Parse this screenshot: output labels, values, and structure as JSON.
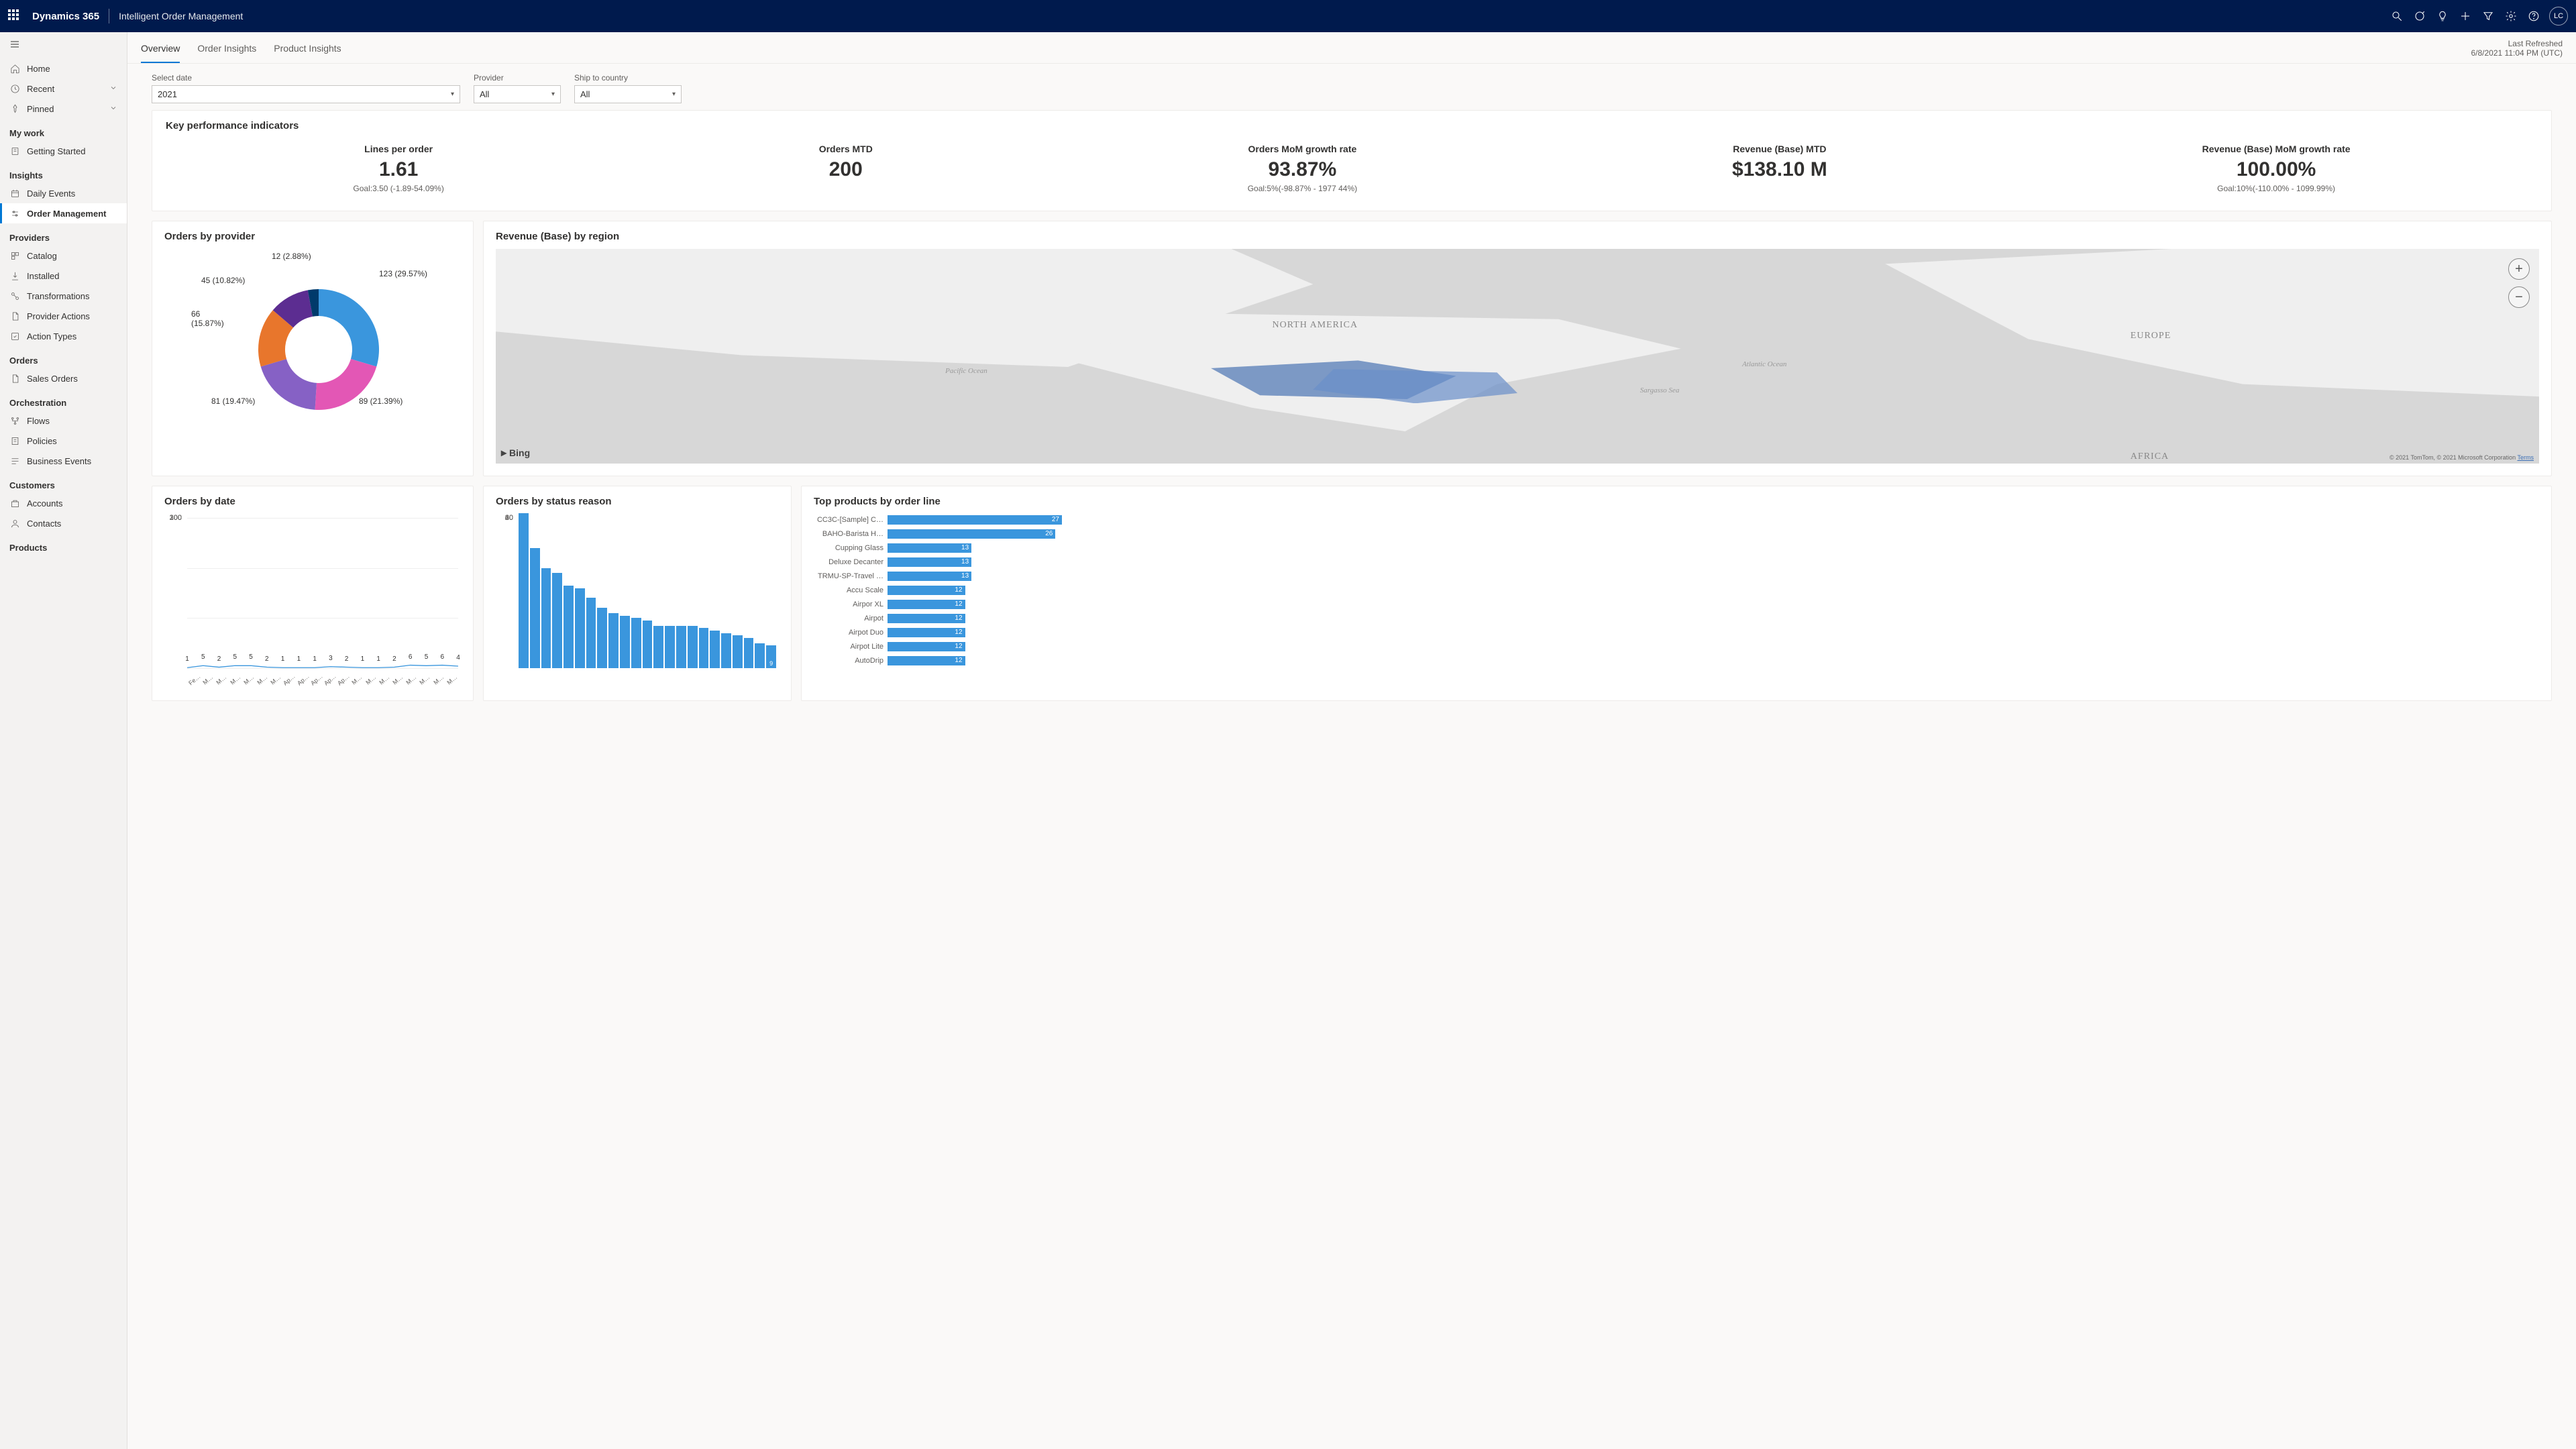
{
  "topbar": {
    "brand": "Dynamics 365",
    "app_name": "Intelligent Order Management",
    "avatar_initials": "LC"
  },
  "sidebar": {
    "builtin": [
      {
        "label": "Home",
        "icon": "home"
      },
      {
        "label": "Recent",
        "icon": "clock",
        "chevron": true
      },
      {
        "label": "Pinned",
        "icon": "pin",
        "chevron": true
      }
    ],
    "groups": [
      {
        "header": "My work",
        "items": [
          {
            "label": "Getting Started",
            "icon": "guide"
          }
        ]
      },
      {
        "header": "Insights",
        "items": [
          {
            "label": "Daily Events",
            "icon": "events"
          },
          {
            "label": "Order Management",
            "icon": "sliders",
            "active": true
          }
        ]
      },
      {
        "header": "Providers",
        "items": [
          {
            "label": "Catalog",
            "icon": "catalog"
          },
          {
            "label": "Installed",
            "icon": "download"
          },
          {
            "label": "Transformations",
            "icon": "transform"
          },
          {
            "label": "Provider Actions",
            "icon": "doc"
          },
          {
            "label": "Action Types",
            "icon": "action"
          }
        ]
      },
      {
        "header": "Orders",
        "items": [
          {
            "label": "Sales Orders",
            "icon": "doc"
          }
        ]
      },
      {
        "header": "Orchestration",
        "items": [
          {
            "label": "Flows",
            "icon": "flow"
          },
          {
            "label": "Policies",
            "icon": "policy"
          },
          {
            "label": "Business Events",
            "icon": "bevent"
          }
        ]
      },
      {
        "header": "Customers",
        "items": [
          {
            "label": "Accounts",
            "icon": "account"
          },
          {
            "label": "Contacts",
            "icon": "person"
          }
        ]
      },
      {
        "header": "Products",
        "items": []
      }
    ]
  },
  "tabs": [
    {
      "label": "Overview",
      "active": true
    },
    {
      "label": "Order Insights"
    },
    {
      "label": "Product Insights"
    }
  ],
  "last_refreshed": {
    "label": "Last Refreshed",
    "value": "6/8/2021 11:04 PM (UTC)"
  },
  "filters": {
    "date": {
      "label": "Select date",
      "value": "2021"
    },
    "provider": {
      "label": "Provider",
      "value": "All"
    },
    "ship_to": {
      "label": "Ship to country",
      "value": "All"
    }
  },
  "kpi": {
    "title": "Key performance indicators",
    "items": [
      {
        "label": "Lines per order",
        "value": "1.61",
        "goal": "Goal:3.50 (-1.89-54.09%)"
      },
      {
        "label": "Orders MTD",
        "value": "200",
        "goal": ""
      },
      {
        "label": "Orders MoM growth rate",
        "value": "93.87%",
        "goal": "Goal:5%(-98.87% - 1977 44%)"
      },
      {
        "label": "Revenue (Base) MTD",
        "value": "$138.10 M",
        "goal": ""
      },
      {
        "label": "Revenue (Base) MoM growth rate",
        "value": "100.00%",
        "goal": "Goal:10%(-110.00% - 1099.99%)"
      }
    ]
  },
  "donut_title": "Orders by provider",
  "map": {
    "title": "Revenue (Base) by region",
    "labels": {
      "na": "NORTH AMERICA",
      "eu": "EUROPE",
      "af": "AFRICA",
      "pac": "Pacific Ocean",
      "atl": "Atlantic Ocean",
      "sar": "Sargasso Sea"
    },
    "bing": "Bing",
    "attrib": "© 2021 TomTom, © 2021 Microsoft Corporation",
    "terms": "Terms"
  },
  "orders_by_date_title": "Orders by date",
  "orders_by_status_title": "Orders by status reason",
  "top_products_title": "Top products by order line",
  "chart_data": {
    "orders_by_provider": {
      "type": "pie",
      "title": "Orders by provider",
      "slices": [
        {
          "value": 123,
          "pct": 29.57,
          "color": "#3a96dd"
        },
        {
          "value": 89,
          "pct": 21.39,
          "color": "#e357b5"
        },
        {
          "value": 81,
          "pct": 19.47,
          "color": "#8661c5"
        },
        {
          "value": 66,
          "pct": 15.87,
          "color": "#e8762c"
        },
        {
          "value": 45,
          "pct": 10.82,
          "color": "#5c2d91"
        },
        {
          "value": 12,
          "pct": 2.88,
          "color": "#003a6b"
        }
      ]
    },
    "orders_by_date": {
      "type": "line",
      "title": "Orders by date",
      "ylabel": "",
      "ylim": [
        0,
        300
      ],
      "yticks": [
        0,
        100,
        200,
        300
      ],
      "x_labels": [
        "Fe…",
        "M…",
        "M…",
        "M…",
        "M…",
        "M…",
        "M…",
        "Ap…",
        "Ap…",
        "Ap…",
        "Ap…",
        "Ap…",
        "M…",
        "M…",
        "M…",
        "M…",
        "M…",
        "M…",
        "M…",
        "M…"
      ],
      "values": [
        1,
        5,
        2,
        5,
        5,
        2,
        1,
        1,
        1,
        3,
        2,
        1,
        1,
        2,
        6,
        5,
        6,
        4
      ]
    },
    "orders_by_status_reason": {
      "type": "bar",
      "title": "Orders by status reason",
      "ylabel": "",
      "ylim": [
        0,
        60
      ],
      "yticks": [
        20,
        40,
        60
      ],
      "values": [
        62,
        48,
        40,
        38,
        33,
        32,
        28,
        24,
        22,
        21,
        20,
        19,
        17,
        17,
        17,
        17,
        16,
        15,
        14,
        13,
        12,
        10,
        9
      ]
    },
    "top_products_by_order_line": {
      "type": "bar",
      "orientation": "horizontal",
      "title": "Top products by order line",
      "categories": [
        "CC3C-[Sample] C…",
        "BAHO-Barista H…",
        "Cupping Glass",
        "Deluxe Decanter",
        "TRMU-SP-Travel …",
        "Accu Scale",
        "Airpor XL",
        "Airpot",
        "Airpot Duo",
        "Airpot Lite",
        "AutoDrip"
      ],
      "values": [
        27,
        26,
        13,
        13,
        13,
        12,
        12,
        12,
        12,
        12,
        12
      ]
    }
  }
}
